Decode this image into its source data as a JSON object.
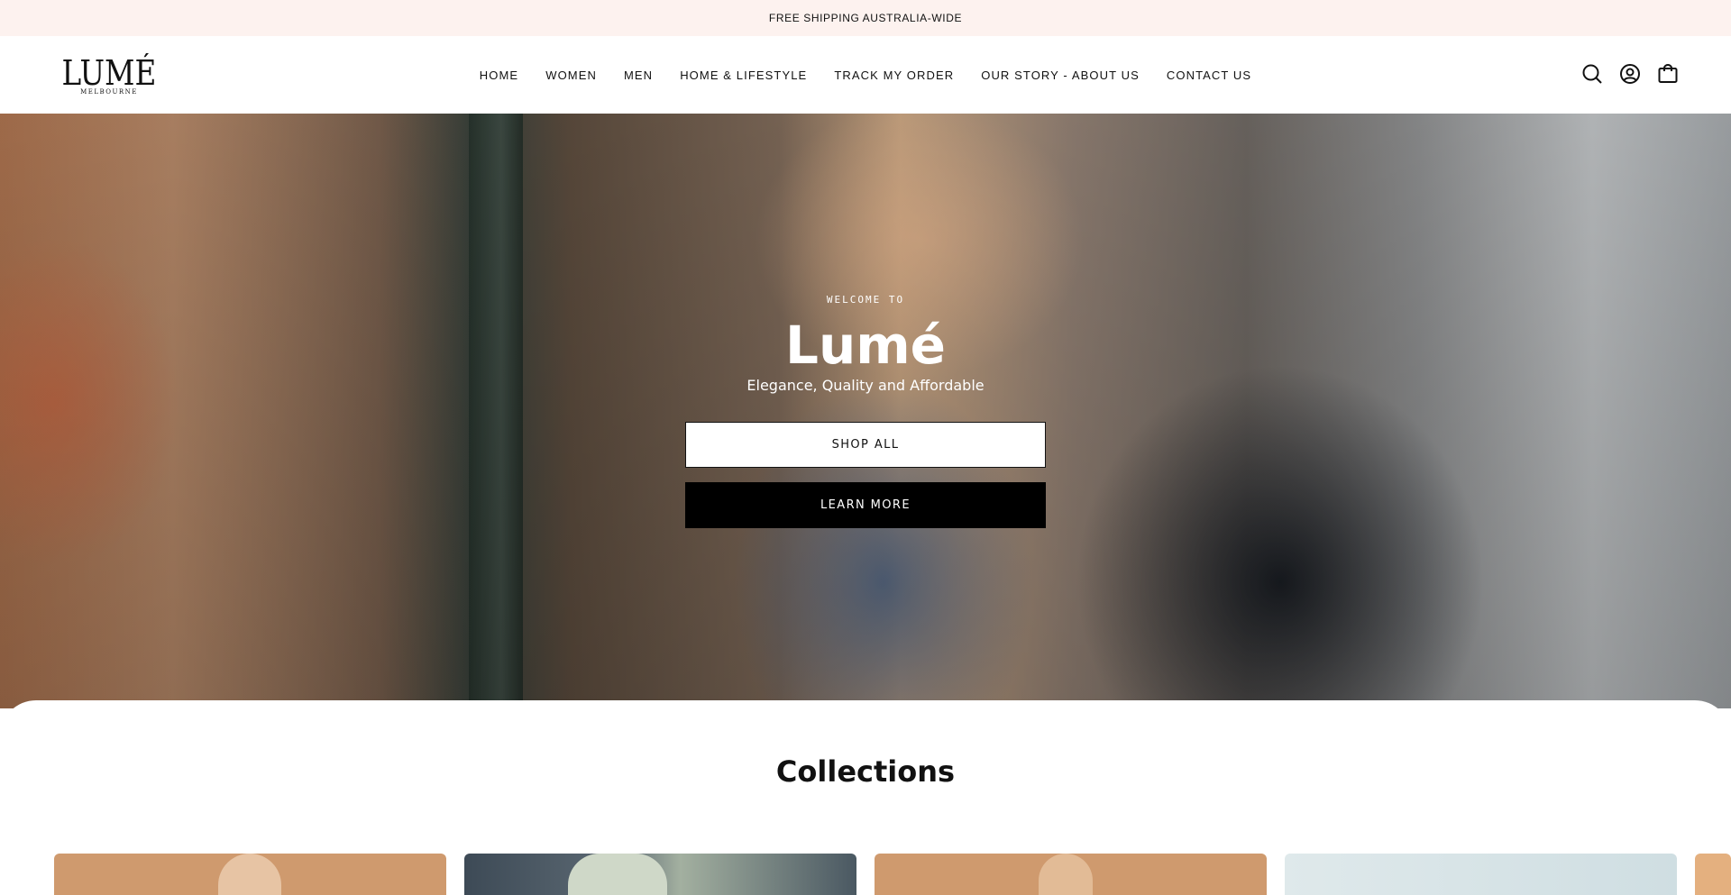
{
  "announcement": {
    "text": "FREE SHIPPING AUSTRALIA-WIDE"
  },
  "header": {
    "logo": {
      "wordmark": "LUMÉ",
      "tagline": "MELBOURNE"
    },
    "nav": [
      {
        "label": "HOME"
      },
      {
        "label": "WOMEN"
      },
      {
        "label": "MEN"
      },
      {
        "label": "HOME & LIFESTYLE"
      },
      {
        "label": "TRACK MY ORDER"
      },
      {
        "label": "OUR STORY - ABOUT US"
      },
      {
        "label": "CONTACT US"
      }
    ],
    "icons": [
      "search-icon",
      "account-icon",
      "cart-icon"
    ]
  },
  "hero": {
    "eyebrow": "WELCOME TO",
    "title": "Lumé",
    "subtitle": "Elegance, Quality and Affordable",
    "primary_button": "SHOP ALL",
    "secondary_button": "LEARN MORE"
  },
  "collections": {
    "heading": "Collections"
  },
  "colors": {
    "announcement_bg": "#fdf2ef",
    "primary_text": "#111111",
    "button_dark": "#000000",
    "button_light": "#ffffff"
  }
}
